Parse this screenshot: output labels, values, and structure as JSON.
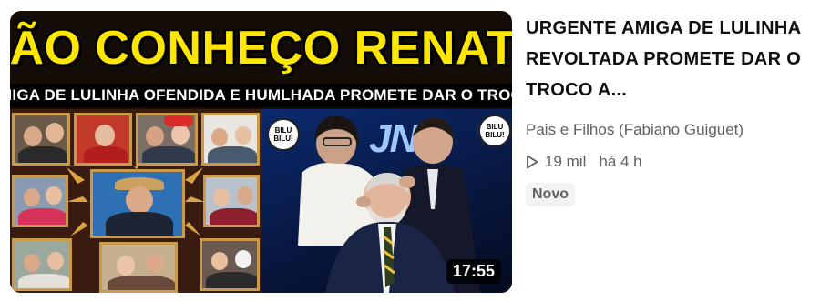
{
  "video": {
    "thumbnail": {
      "headline": "“NÃO CONHEÇO RENATA”",
      "subheadline": "AMIGA DE LULINHA OFENDIDA E HUMLHADA PROMETE DAR O TROCO",
      "bilu_text": "BILU BILU!",
      "logo_text": "JN",
      "duration": "17:55"
    },
    "title": "URGENTE AMIGA DE LULINHA REVOLTADA PROMETE DAR O TROCO A...",
    "channel": "Pais e Filhos (Fabiano Guiguet)",
    "views": "19 mil",
    "age": "há 4 h",
    "badge": "Novo",
    "icons": {
      "views": "play-icon"
    },
    "colors": {
      "headline": "#ffe600",
      "title": "#0f0f0f",
      "secondary": "#606060",
      "badge_bg": "#f2f2f2"
    }
  }
}
